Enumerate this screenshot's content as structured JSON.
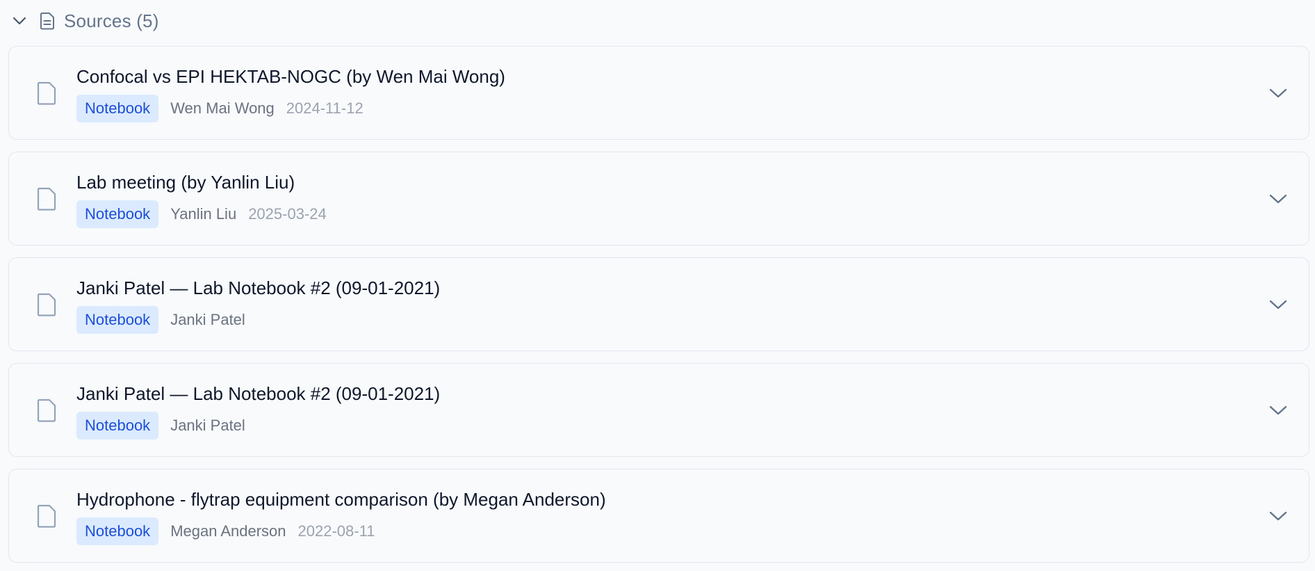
{
  "header": {
    "title": "Sources (5)",
    "collapse_icon": "chevron-down-icon",
    "doc_icon": "document-text-icon"
  },
  "colors": {
    "badge_bg": "#dbeafe",
    "badge_text": "#1d4ed8",
    "border": "#e2e8f0",
    "background": "#f8fafc"
  },
  "sources": [
    {
      "title": "Confocal vs EPI HEKTAB-NOGC (by Wen Mai Wong)",
      "badge": "Notebook",
      "author": "Wen Mai Wong",
      "date": "2024-11-12",
      "icon": "file-icon"
    },
    {
      "title": "Lab meeting (by Yanlin Liu)",
      "badge": "Notebook",
      "author": "Yanlin Liu",
      "date": "2025-03-24",
      "icon": "file-icon"
    },
    {
      "title": "Janki Patel — Lab Notebook #2 (09-01-2021)",
      "badge": "Notebook",
      "author": "Janki Patel",
      "date": "",
      "icon": "file-icon"
    },
    {
      "title": "Janki Patel — Lab Notebook #2 (09-01-2021)",
      "badge": "Notebook",
      "author": "Janki Patel",
      "date": "",
      "icon": "file-icon"
    },
    {
      "title": "Hydrophone - flytrap equipment comparison (by Megan Anderson)",
      "badge": "Notebook",
      "author": "Megan Anderson",
      "date": "2022-08-11",
      "icon": "file-icon"
    }
  ]
}
